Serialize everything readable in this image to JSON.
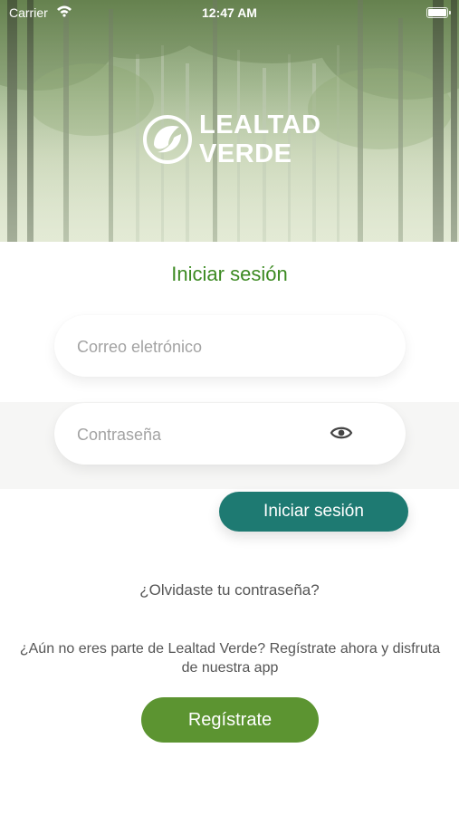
{
  "status_bar": {
    "carrier": "Carrier",
    "time": "12:47 AM"
  },
  "brand": {
    "name_line1": "LEALTAD",
    "name_line2": "VERDE"
  },
  "login": {
    "title": "Iniciar sesión",
    "email_placeholder": "Correo eletrónico",
    "password_placeholder": "Contraseña",
    "submit_label": "Iniciar sesión",
    "forgot_password": "¿Olvidaste tu contraseña?"
  },
  "register": {
    "prompt": "¿Aún no eres parte de Lealtad Verde? Regístrate ahora y disfruta de nuestra app",
    "button_label": "Regístrate"
  },
  "colors": {
    "title_green": "#3c8a22",
    "login_button": "#1e7a72",
    "register_button": "#5c9431"
  },
  "icons": {
    "password_toggle": "eye-icon",
    "signal": "wifi-icon",
    "battery": "battery-icon"
  }
}
